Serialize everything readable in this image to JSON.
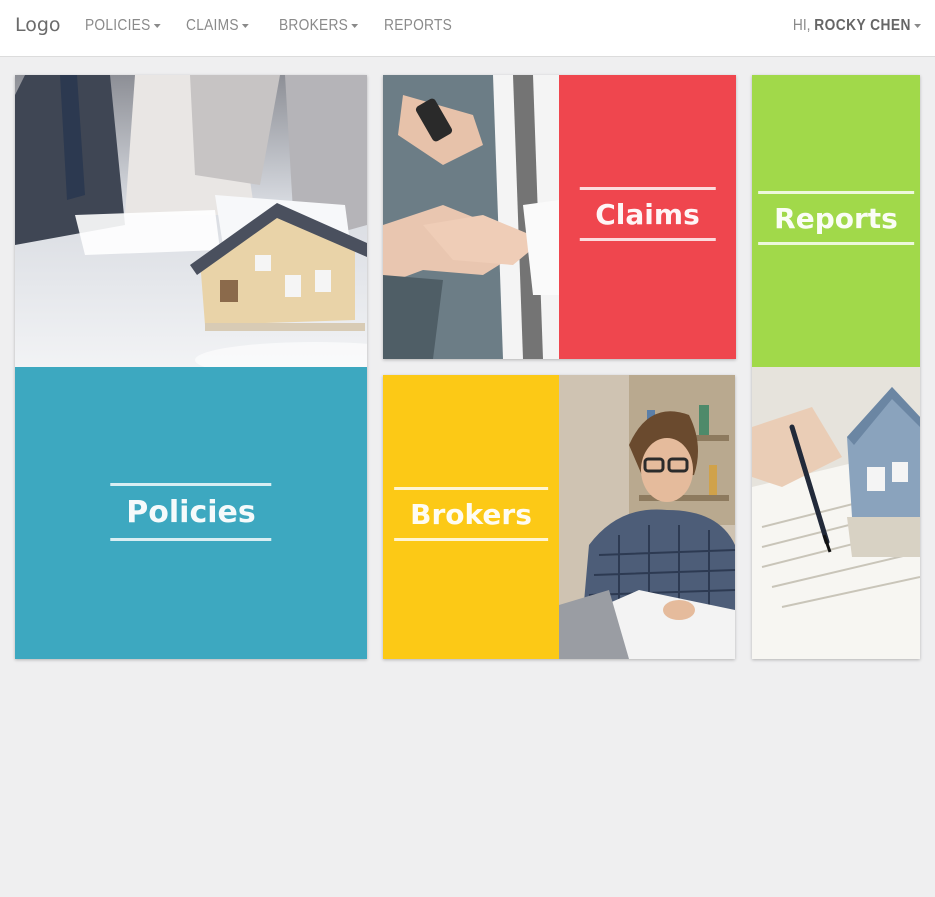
{
  "nav": {
    "logo": "Logo",
    "items": [
      "POLICIES",
      "CLAIMS",
      "BROKERS",
      "REPORTS"
    ],
    "user_greeting": "HI,",
    "user_name": "ROCKY CHEN"
  },
  "tiles": {
    "policies": {
      "label": "Policies",
      "color": "#3da8c0"
    },
    "claims": {
      "label": "Claims",
      "color": "#ef464e"
    },
    "brokers": {
      "label": "Brokers",
      "color": "#fcc916"
    },
    "reports": {
      "label": "Reports",
      "color": "#a1d94a"
    }
  }
}
